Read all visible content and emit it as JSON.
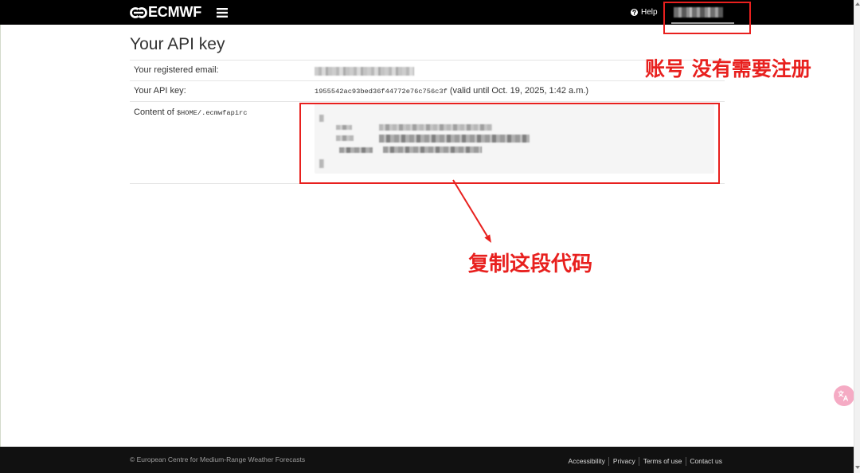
{
  "navbar": {
    "logo_text": "ECMWF",
    "help_label": "Help"
  },
  "page": {
    "title": "Your API key"
  },
  "details": {
    "email_label": "Your registered email:",
    "api_key_label": "Your API key:",
    "api_key_value": "1955542ac93bed36f44772e76c756c3f",
    "api_key_validity": "(valid until Oct. 19, 2025, 1:42 a.m.)",
    "config_label_prefix": "Content of ",
    "config_label_path": "$HOME/.ecmwfapirc"
  },
  "annotations": {
    "account_note": "账号 没有需要注册",
    "copy_note": "复制这段代码"
  },
  "footer": {
    "copyright": "© European Centre for Medium-Range Weather Forecasts",
    "links": [
      "Accessibility",
      "Privacy",
      "Terms of use",
      "Contact us"
    ]
  },
  "icons": {
    "logo": "ecmwf-logo-icon",
    "menu": "hamburger-menu-icon",
    "help": "question-circle-icon",
    "translate": "translate-icon"
  },
  "colors": {
    "navbar_background": "#000000",
    "footer_background": "#111111",
    "annotation_red": "#e8201e",
    "code_background": "#f5f5f5",
    "translate_widget": "#f5abc4"
  }
}
